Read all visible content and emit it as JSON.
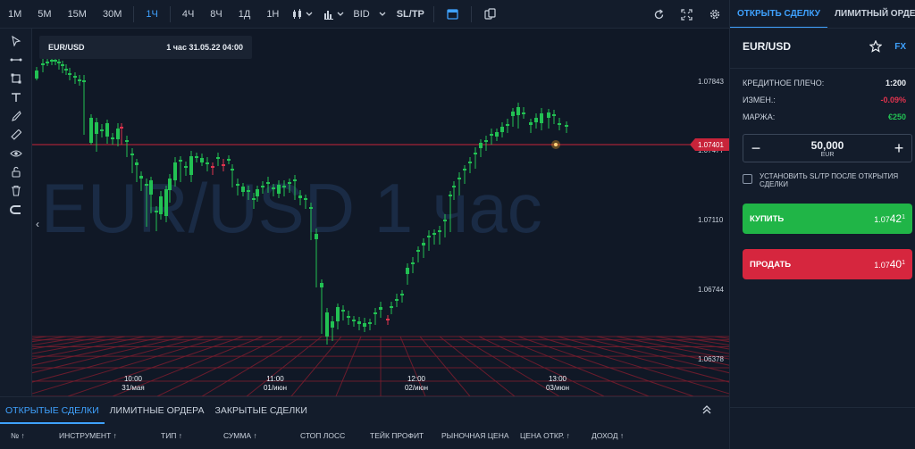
{
  "toolbar": {
    "timeframes": [
      "1M",
      "5M",
      "15M",
      "30M",
      "1Ч",
      "4Ч",
      "8Ч",
      "1Д",
      "1Н"
    ],
    "active_timeframe": "1Ч",
    "bid_label": "BID",
    "sltp_label": "SL/TP"
  },
  "chart": {
    "instrument": "EUR/USD",
    "timestamp": "1 час 31.05.22 04:00",
    "watermark": "EUR/USD  1 час",
    "current_price_label": "1.07401",
    "price_labels": [
      "1.07843",
      "1.07477",
      "1.07110",
      "1.06744",
      "1.06378"
    ],
    "time_labels": [
      {
        "time": "10:00",
        "date": "31/мая"
      },
      {
        "time": "11:00",
        "date": "01/июн"
      },
      {
        "time": "12:00",
        "date": "02/июн"
      },
      {
        "time": "13:00",
        "date": "03/июн"
      }
    ],
    "colors": {
      "up": "#22c153",
      "down": "#e0334e",
      "price_line": "#c8243a",
      "grid": "#7a1d2e"
    }
  },
  "bottom": {
    "tabs": [
      "ОТКРЫТЫЕ СДЕЛКИ",
      "ЛИМИТНЫЕ ОРДЕРА",
      "ЗАКРЫТЫЕ СДЕЛКИ"
    ],
    "columns": [
      "№ ↑",
      "ИНСТРУМЕНТ ↑",
      "ТИП ↑",
      "СУММА ↑",
      "СТОП ЛОСС",
      "ТЕЙК ПРОФИТ",
      "РЫНОЧНАЯ ЦЕНА",
      "ЦЕНА ОТКР. ↑",
      "ДОХОД ↑"
    ]
  },
  "panel": {
    "tabs": [
      "ОТКРЫТЬ СДЕЛКУ",
      "ЛИМИТНЫЙ ОРДЕР"
    ],
    "pair": "EUR/USD",
    "market": "FX",
    "leverage_label": "КРЕДИТНОЕ ПЛЕЧО:",
    "leverage_value": "1:200",
    "change_label": "ИЗМЕН.:",
    "change_value": "-0.09%",
    "margin_label": "МАРЖА:",
    "margin_value": "€250",
    "amount": "50,000",
    "currency": "EUR",
    "checkbox_label": "УСТАНОВИТЬ SL/TP ПОСЛЕ ОТКРЫТИЯ СДЕЛКИ",
    "buy_label": "КУПИТЬ",
    "buy_price_main": "1.07",
    "buy_price_big": "42",
    "buy_price_sup": "1",
    "sell_label": "ПРОДАТЬ",
    "sell_price_main": "1.07",
    "sell_price_big": "40",
    "sell_price_sup": "1"
  }
}
